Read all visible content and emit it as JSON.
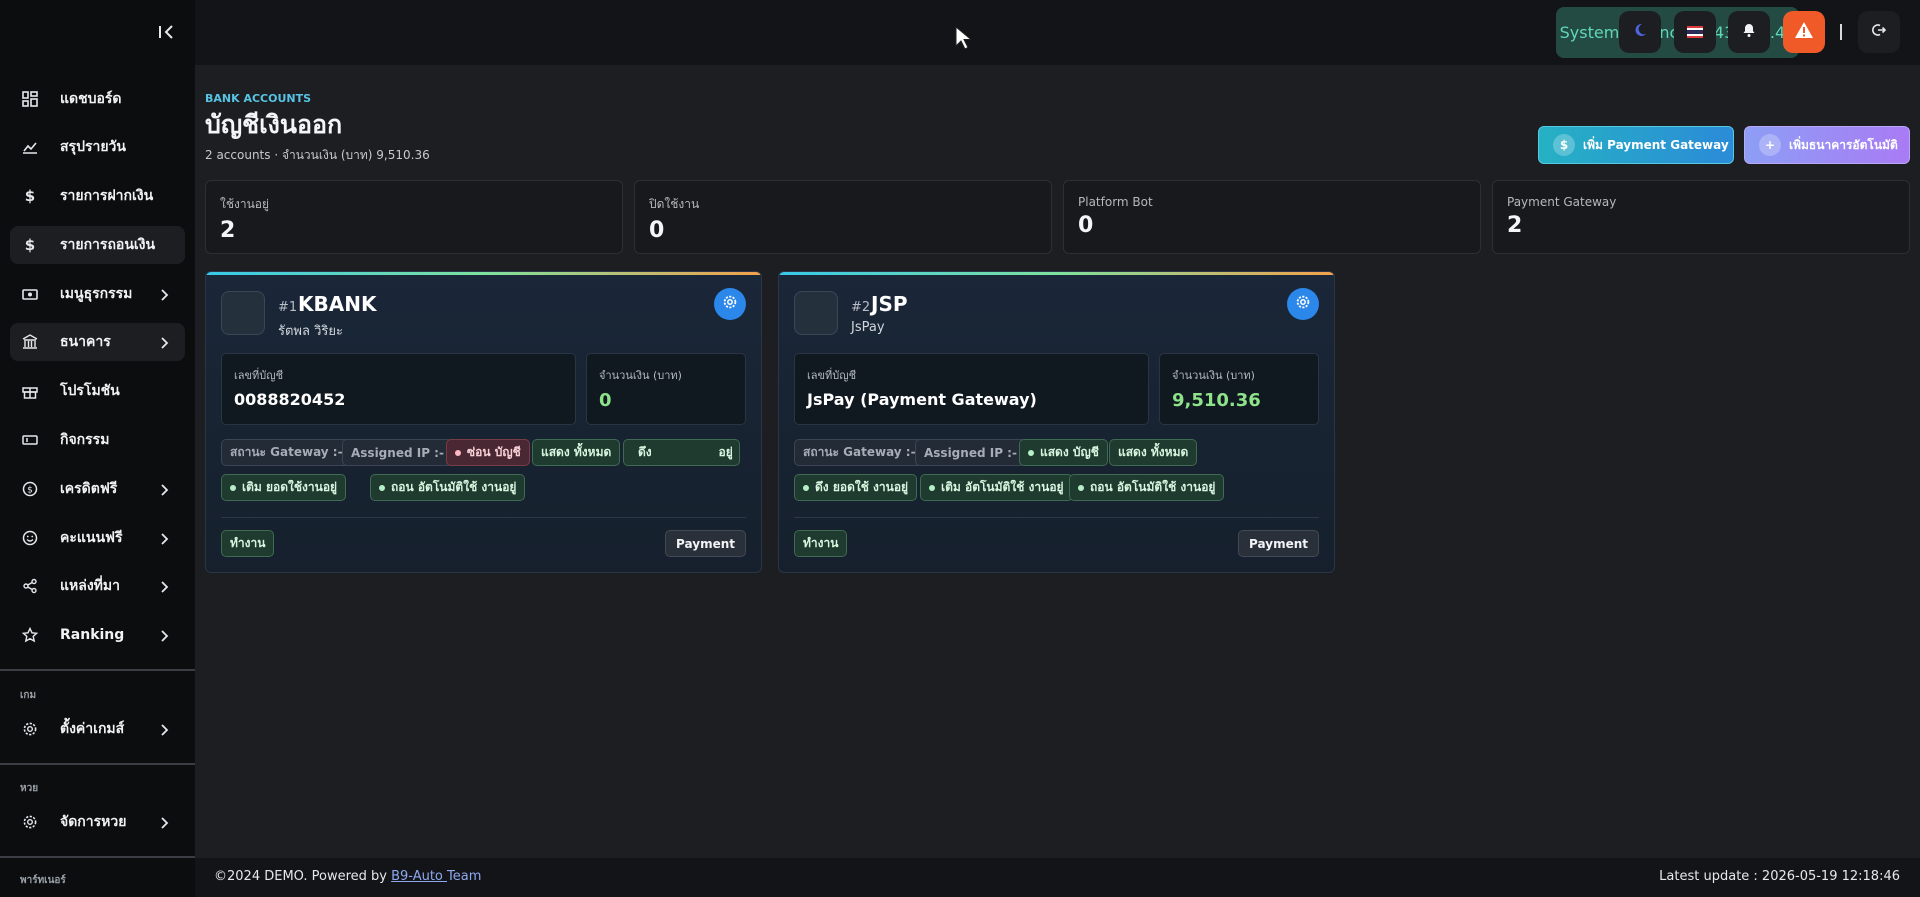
{
  "sidebar": {
    "items": [
      {
        "label": "แดชบอร์ด",
        "icon": "dashboard-icon"
      },
      {
        "label": "สรุปรายวัน",
        "icon": "chart-icon"
      },
      {
        "label": "รายการฝากเงิน",
        "icon": "dollar-icon"
      },
      {
        "label": "รายการถอนเงิน",
        "icon": "dollar-icon"
      },
      {
        "label": "เมนูธุรกรรม",
        "icon": "money-icon"
      },
      {
        "label": "ธนาคาร",
        "icon": "bank-icon"
      },
      {
        "label": "โปรโมชัน",
        "icon": "gift-icon"
      },
      {
        "label": "กิจกรรม",
        "icon": "ticket-icon"
      },
      {
        "label": "เครดิตฟรี",
        "icon": "coin-icon"
      },
      {
        "label": "คะแนนฟรี",
        "icon": "smile-icon"
      },
      {
        "label": "แหล่งที่มา",
        "icon": "share-icon"
      },
      {
        "label": "Ranking",
        "icon": "star-icon"
      }
    ],
    "section_game": "เกม",
    "game_settings": "ตั้งค่าเกมส์",
    "section_lotto": "หวย",
    "lotto_manage": "จัดการหวย",
    "section_partner": "พาร์ทเนอร์"
  },
  "topbar": {
    "balance": "System Balance : 443,547.45"
  },
  "page": {
    "eyebrow": "BANK ACCOUNTS",
    "title": "บัญชีเงินออก",
    "subtitle": "2 accounts · จำนวนเงิน (บาท) 9,510.36",
    "add_gateway": "เพิ่ม Payment Gateway",
    "add_bank": "เพิ่มธนาคารอัตโนมัติ"
  },
  "stats": [
    {
      "label": "ใช้งานอยู่",
      "value": "2"
    },
    {
      "label": "ปิดใช้งาน",
      "value": "0"
    },
    {
      "label": "Platform Bot",
      "value": "0"
    },
    {
      "label": "Payment Gateway",
      "value": "2"
    }
  ],
  "cards": [
    {
      "num": "#1",
      "name": "KBANK",
      "owner": "รัตพล วิริยะ",
      "account_label": "เลขที่บัญชี",
      "account_value": "0088820452",
      "amount_label": "จำนวนเงิน (บาท)",
      "amount_value": "0",
      "tag_gateway": "สถานะ Gateway :-",
      "tag_ip": "Assigned IP :-",
      "tag_hide": "ซ่อน บัญชี",
      "tag_show_all": "แสดง ทั้งหมด",
      "tag_withdraw": "ดึง                อยู่",
      "tag_deposit": "เติม ยอดใช้งานอยู่",
      "tag_auto_withdraw": "ถอน อัตโนมัติใช้ งานอยู่",
      "status": "ทำงาน",
      "type": "Payment"
    },
    {
      "num": "#2",
      "name": "JSP",
      "owner": "JsPay",
      "account_label": "เลขที่บัญชี",
      "account_value": "JsPay (Payment Gateway)",
      "amount_label": "จำนวนเงิน (บาท)",
      "amount_value": "9,510.36",
      "tag_gateway": "สถานะ Gateway :-",
      "tag_ip": "Assigned IP :-",
      "tag_show_account": "แสดง บัญชี",
      "tag_show_all": "แสดง ทั้งหมด",
      "tag_pull": "ดึง ยอดใช้ งานอยู่",
      "tag_deposit": "เติม อัตโนมัติใช้ งานอยู่",
      "tag_auto_withdraw": "ถอน อัตโนมัติใช้ งานอยู่",
      "status": "ทำงาน",
      "type": "Payment"
    }
  ],
  "footer": {
    "copyright": "©2024 DEMO. Powered by ",
    "link": "B9-Auto ",
    "team": "Team",
    "updated": "Latest update : 2026-05-19 12:18:46"
  }
}
